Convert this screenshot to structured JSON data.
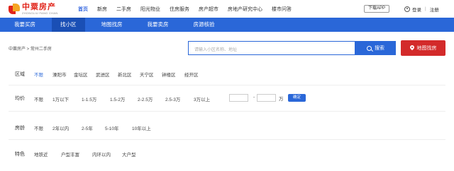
{
  "logo": {
    "cn": "中粟房产",
    "en": "ZHONGLIU FANG CHAN"
  },
  "top_nav": [
    {
      "label": "首页",
      "active": true
    },
    {
      "label": "新房",
      "active": false
    },
    {
      "label": "二手房",
      "active": false
    },
    {
      "label": "阳光物业",
      "active": false
    },
    {
      "label": "住房服务",
      "active": false
    },
    {
      "label": "房产超市",
      "active": false
    },
    {
      "label": "房地产研究中心",
      "active": false
    },
    {
      "label": "楼市问答",
      "active": false
    }
  ],
  "header": {
    "download_app": "下载APP",
    "login": "登录",
    "register": "注册"
  },
  "blue_nav": [
    {
      "label": "我要买房",
      "active": false
    },
    {
      "label": "找小区",
      "active": true
    },
    {
      "label": "地图找房",
      "active": false
    },
    {
      "label": "我要卖房",
      "active": false
    },
    {
      "label": "房源核验",
      "active": false
    }
  ],
  "breadcrumb": "中粟房产 > 常州二手房",
  "search": {
    "placeholder": "请输入小区名称、地址",
    "button": "搜索",
    "map_button": "地图找房"
  },
  "filters": {
    "district": {
      "label": "区域",
      "options": [
        "不限",
        "溧阳市",
        "金坛区",
        "武进区",
        "新北区",
        "天宁区",
        "钟楼区",
        "经开区"
      ],
      "active": 0
    },
    "price": {
      "label": "均价",
      "options": [
        "不限",
        "1万以下",
        "1-1.5万",
        "1.5-2万",
        "2-2.5万",
        "2.5-3万",
        "3万以上"
      ],
      "active": -1,
      "dash": "-",
      "unit": "万",
      "confirm": "确定"
    },
    "age": {
      "label": "房龄",
      "options": [
        "不限",
        "2年以内",
        "2-5年",
        "5-10年",
        "10年以上"
      ],
      "active": -1
    },
    "feature": {
      "label": "特色",
      "options": [
        "地铁近",
        "户型丰富",
        "内环以内",
        "大户型"
      ],
      "active": -1
    }
  },
  "colors": {
    "brand_blue": "#2a67d8",
    "map_red": "#d32a2a",
    "logo_red": "#e1251b"
  }
}
